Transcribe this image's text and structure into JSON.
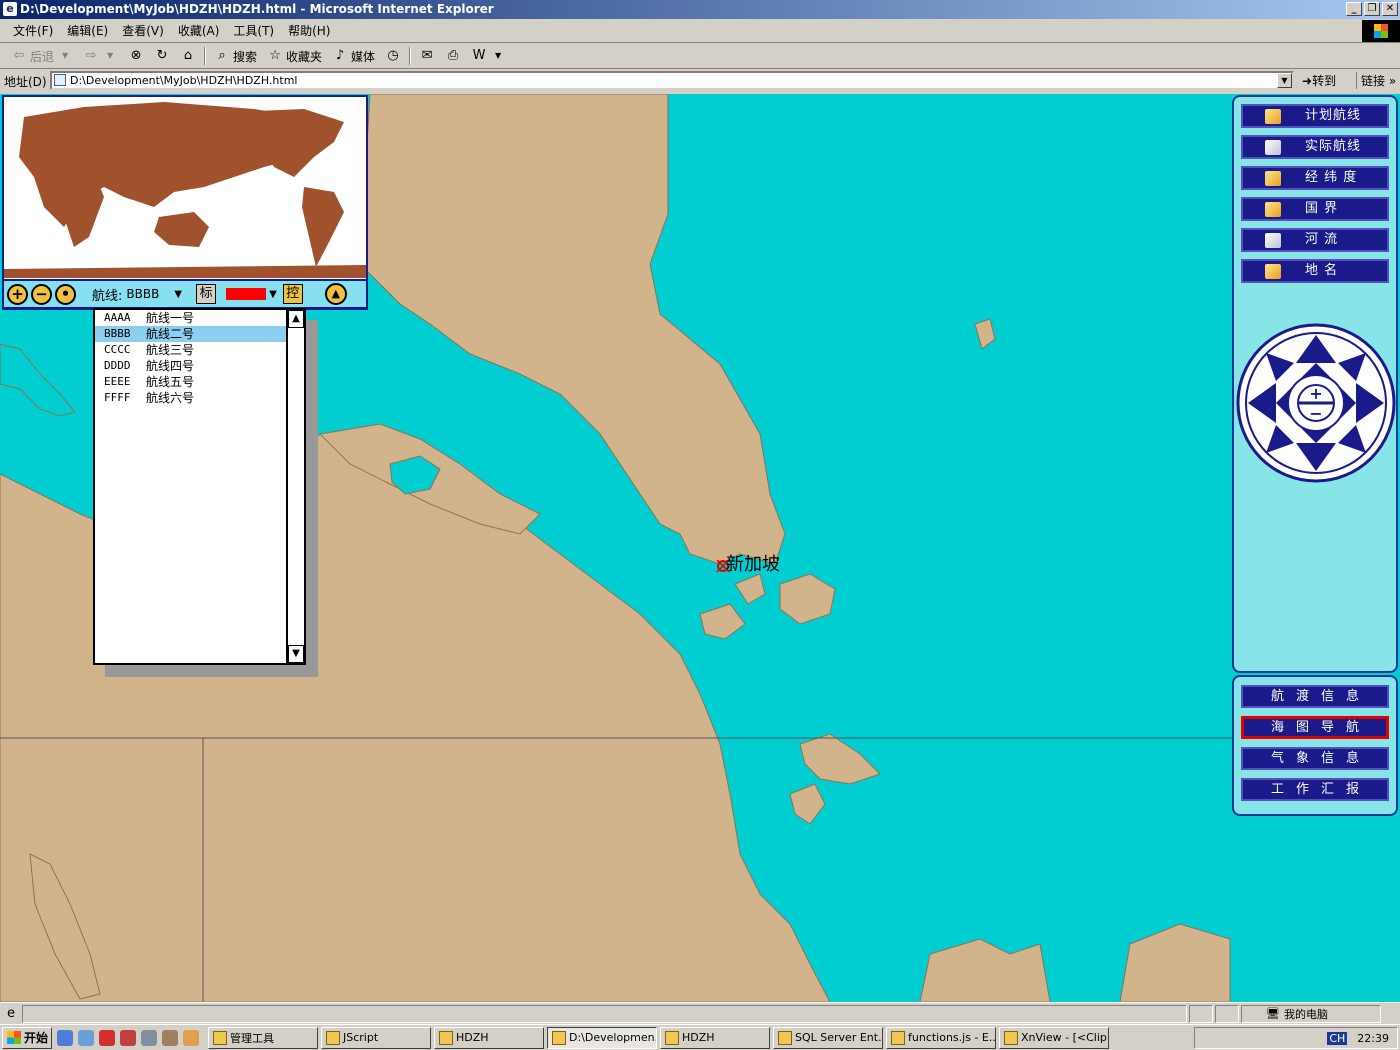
{
  "window": {
    "title": "D:\\Development\\MyJob\\HDZH\\HDZH.html - Microsoft Internet Explorer",
    "minimize": "_",
    "restore": "❐",
    "close": "✕"
  },
  "menu": [
    "文件(F)",
    "编辑(E)",
    "查看(V)",
    "收藏(A)",
    "工具(T)",
    "帮助(H)"
  ],
  "toolbar": {
    "back": "后退",
    "search": "搜索",
    "favorites": "收藏夹",
    "media": "媒体"
  },
  "address": {
    "label": "地址(D)",
    "value": "D:\\Development\\MyJob\\HDZH\\HDZH.html",
    "go": "转到",
    "links": "链接"
  },
  "map_control": {
    "zoom_in": "+",
    "zoom_out": "−",
    "center": "•",
    "route_label": "航线:",
    "route_value": "BBBB",
    "mark_button": "标",
    "control_button": "控",
    "route_color": "#ff0000",
    "eject": "▲"
  },
  "route_list": [
    {
      "code": "AAAA",
      "name": "航线一号",
      "selected": false
    },
    {
      "code": "BBBB",
      "name": "航线二号",
      "selected": true
    },
    {
      "code": "CCCC",
      "name": "航线三号",
      "selected": false
    },
    {
      "code": "DDDD",
      "name": "航线四号",
      "selected": false
    },
    {
      "code": "EEEE",
      "name": "航线五号",
      "selected": false
    },
    {
      "code": "FFFF",
      "name": "航线六号",
      "selected": false
    }
  ],
  "layers": [
    {
      "label": "计划航线",
      "checked": true
    },
    {
      "label": "实际航线",
      "checked": false
    },
    {
      "label": "经 纬 度",
      "checked": true
    },
    {
      "label": "国   界",
      "checked": true
    },
    {
      "label": "河   流",
      "checked": false
    },
    {
      "label": "地   名",
      "checked": true
    }
  ],
  "functions": [
    {
      "label": "航渡信息",
      "active": false
    },
    {
      "label": "海图导航",
      "active": true
    },
    {
      "label": "气象信息",
      "active": false
    },
    {
      "label": "工作汇报",
      "active": false
    }
  ],
  "map": {
    "place_name": "新加坡",
    "sea_color": "#00ced1",
    "land_color": "#d2b48c"
  },
  "status": {
    "zone": "我的电脑"
  },
  "taskbar": {
    "start": "开始",
    "tasks": [
      {
        "label": "管理工具",
        "active": false
      },
      {
        "label": "JScript",
        "active": false
      },
      {
        "label": "HDZH",
        "active": false
      },
      {
        "label": "D:\\Developmen...",
        "active": true
      },
      {
        "label": "HDZH",
        "active": false
      },
      {
        "label": "SQL Server Ent...",
        "active": false
      },
      {
        "label": "functions.js - E...",
        "active": false
      },
      {
        "label": "XnView - [<Clip...",
        "active": false
      }
    ],
    "ime": "CH",
    "clock": "22:39"
  }
}
